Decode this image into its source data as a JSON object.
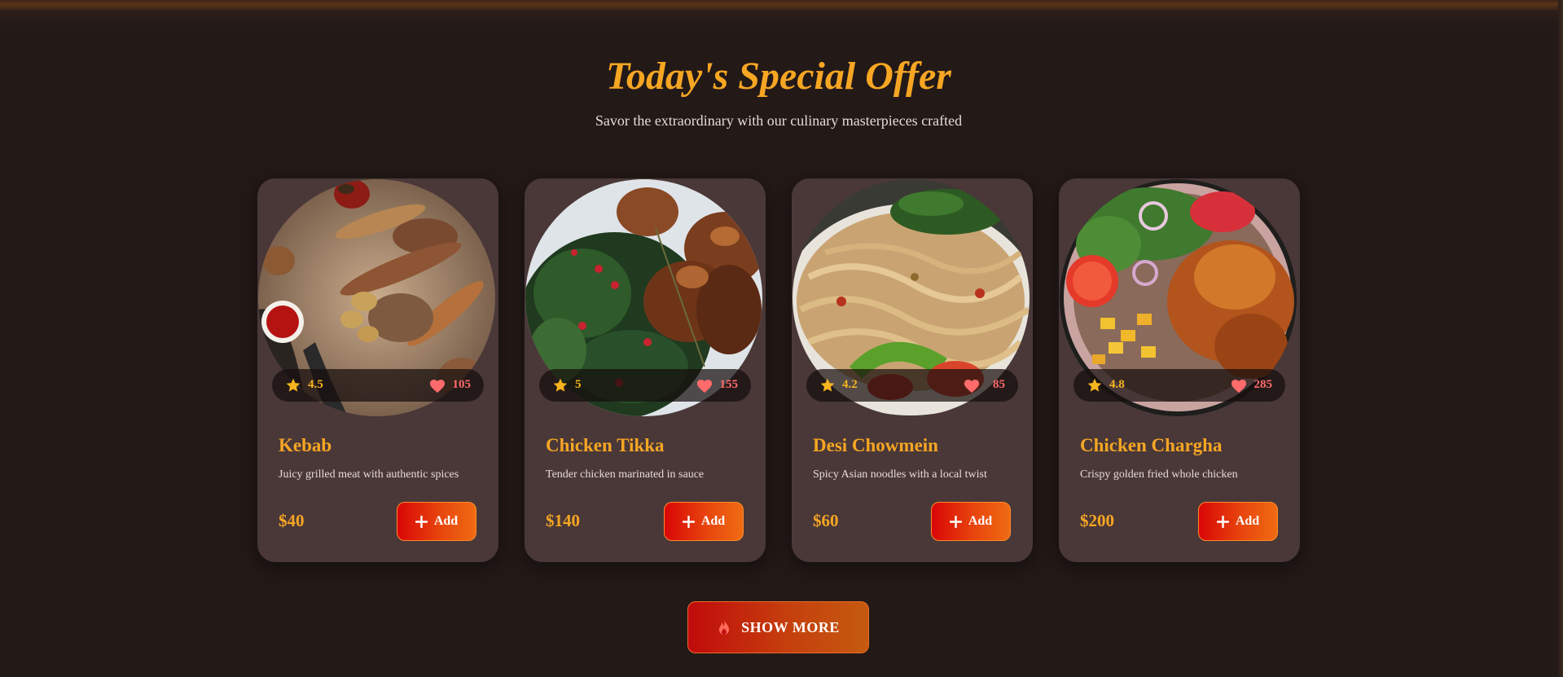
{
  "section": {
    "title": "Today's Special Offer",
    "subtitle": "Savor the extraordinary with our culinary masterpieces crafted"
  },
  "colors": {
    "background": "#231917",
    "card": "#4a3838",
    "accent": "#f6a623",
    "like": "#ff6b6b",
    "button_start": "#d90606",
    "button_end": "#ef6b12"
  },
  "icons": {
    "rating": "star-icon",
    "likes": "heart-icon",
    "add": "plus-icon",
    "show_more": "fire-icon"
  },
  "dishes": [
    {
      "name": "Kebab",
      "description": "Juicy grilled meat with authentic spices",
      "price": "$40",
      "rating": "4.5",
      "likes": "105",
      "add_label": "Add"
    },
    {
      "name": "Chicken Tikka",
      "description": "Tender chicken marinated in sauce",
      "price": "$140",
      "rating": "5",
      "likes": "155",
      "add_label": "Add"
    },
    {
      "name": "Desi Chowmein",
      "description": "Spicy Asian noodles with a local twist",
      "price": "$60",
      "rating": "4.2",
      "likes": "85",
      "add_label": "Add"
    },
    {
      "name": "Chicken Chargha",
      "description": "Crispy golden fried whole chicken",
      "price": "$200",
      "rating": "4.8",
      "likes": "285",
      "add_label": "Add"
    }
  ],
  "show_more_label": "SHOW MORE"
}
